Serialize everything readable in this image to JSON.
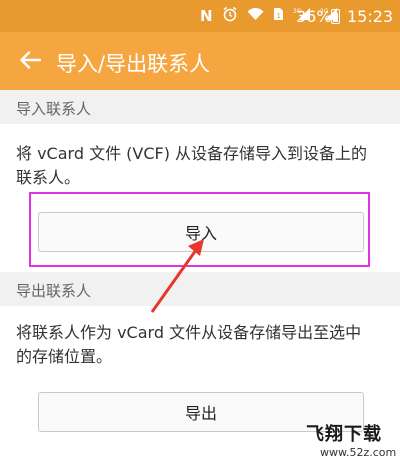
{
  "statusbar": {
    "battery_percent": "36%",
    "time": "15:23",
    "icons": [
      "notification-n-icon",
      "alarm-icon",
      "wifi-icon",
      "sim-icon",
      "signal-icon",
      "signal-icon",
      "battery-icon"
    ]
  },
  "appbar": {
    "title": "导入/导出联系人",
    "back_icon": "arrow-left-icon"
  },
  "import_section": {
    "header": "导入联系人",
    "description_line1": "将 vCard 文件 (VCF) 从设备存储导入到设备上的",
    "description_line2": "联系人。",
    "button_label": "导入"
  },
  "export_section": {
    "header": "导出联系人",
    "description_line1": "将联系人作为 vCard 文件从设备存储导出至选中",
    "description_line2": "的存储位置。",
    "button_label": "导出"
  },
  "watermark": {
    "logo_text": "飞翔下载",
    "url": "www.52z.com"
  },
  "colors": {
    "statusbar": "#e99a2e",
    "appbar": "#f5a640",
    "highlight": "#e033e0",
    "arrow": "#e8362d"
  }
}
